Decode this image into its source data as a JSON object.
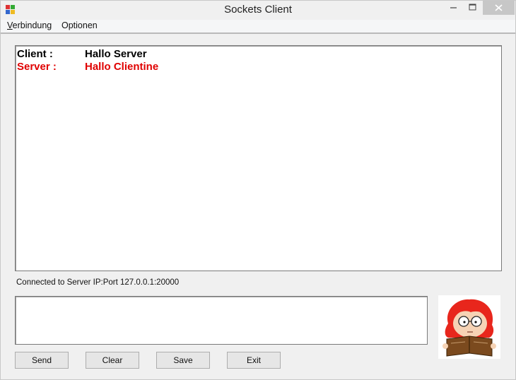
{
  "window": {
    "title": "Sockets Client"
  },
  "menu": {
    "items": [
      "Verbindung",
      "Optionen"
    ]
  },
  "chat": {
    "lines": [
      {
        "sender": "Client  :",
        "message": "Hallo Server",
        "color": "#000000"
      },
      {
        "sender": "Server :",
        "message": "Hallo Clientine",
        "color": "#e00000"
      }
    ]
  },
  "status": {
    "text": "Connected to Server IP:Port 127.0.0.1:20000"
  },
  "input": {
    "value": ""
  },
  "buttons": {
    "send": "Send",
    "clear": "Clear",
    "save": "Save",
    "exit": "Exit"
  },
  "icons": {
    "app": "app-icon",
    "minimize": "minimize-icon",
    "maximize": "maximize-icon",
    "close": "close-icon",
    "avatar": "reading-girl-avatar"
  }
}
